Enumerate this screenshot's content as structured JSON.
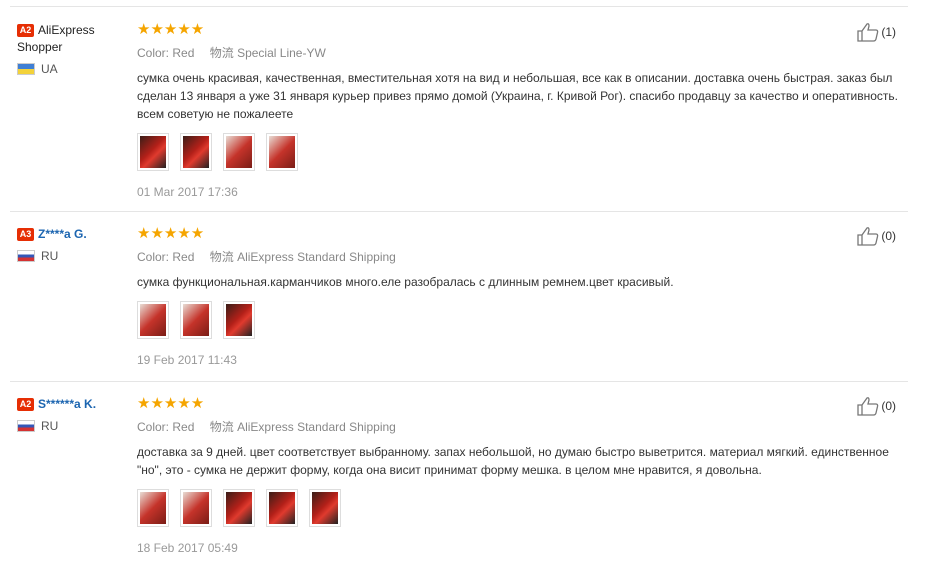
{
  "reviews": [
    {
      "level": "A2",
      "name": "AliExpress Shopper",
      "name_style": "plain",
      "country_code": "ua",
      "country": "UA",
      "rating": 5,
      "stars": "★★★★★",
      "color_label": "Color:",
      "color_value": "Red",
      "shipping_label": "物流",
      "shipping_value": "Special Line-YW",
      "text": "сумка очень красивая, качественная, вместительная хотя на вид и небольшая, все как в описании. доставка очень быстрая. заказ был сделан 13 января а уже 31 января курьер привез прямо домой (Украина, г. Кривой Рог). спасибо продавцу за качество и оперативность. всем советую не пожалеете",
      "thumb_count": 4,
      "date": "01 Mar 2017 17:36",
      "helpful": "(1)"
    },
    {
      "level": "A3",
      "name": "Z****a G.",
      "name_style": "link",
      "country_code": "ru",
      "country": "RU",
      "rating": 5,
      "stars": "★★★★★",
      "color_label": "Color:",
      "color_value": "Red",
      "shipping_label": "物流",
      "shipping_value": "AliExpress Standard Shipping",
      "text": "сумка функциональная.карманчиков много.еле разобралась с длинным ремнем.цвет красивый.",
      "thumb_count": 3,
      "date": "19 Feb 2017 11:43",
      "helpful": "(0)"
    },
    {
      "level": "A2",
      "name": "S******a K.",
      "name_style": "link",
      "country_code": "ru",
      "country": "RU",
      "rating": 5,
      "stars": "★★★★★",
      "color_label": "Color:",
      "color_value": "Red",
      "shipping_label": "物流",
      "shipping_value": "AliExpress Standard Shipping",
      "text": "доставка за 9 дней. цвет соответствует выбранному. запах небольшой, но думаю быстро выветрится. материал мягкий. единственное \"но\", это - сумка не держит форму, когда она висит принимат форму мешка. в целом мне нравится, я довольна.",
      "thumb_count": 5,
      "date": "18 Feb 2017 05:49",
      "helpful": "(0)"
    }
  ]
}
